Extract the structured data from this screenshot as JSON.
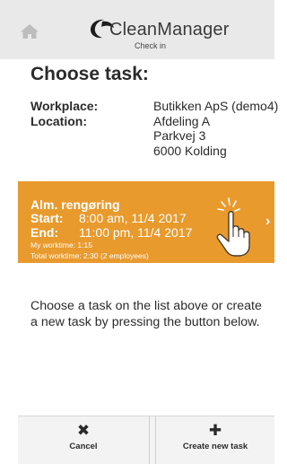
{
  "header": {
    "home_icon": "home-icon",
    "logo_icon": "cleanmanager-logo-icon",
    "app_title": "CleanManager",
    "subtitle": "Check in"
  },
  "main": {
    "title": "Choose task:",
    "info": [
      {
        "label": "Workplace:",
        "value": "Butikken ApS (demo4)"
      },
      {
        "label": "Location:",
        "value": "Afdeling A"
      },
      {
        "label": "",
        "value": "Parkvej 3"
      },
      {
        "label": "",
        "value": "6000 Kolding"
      }
    ],
    "task": {
      "name": "Alm. rengøring",
      "start_label": "Start:",
      "start_value": "8:00 am, 11/4 2017",
      "end_label": "End:",
      "end_value": "11:00 pm, 11/4 2017",
      "my_worktime": "My worktime: 1:15",
      "total_worktime": "Total worktime: 2:30 (2 employees)",
      "color": "#e89a2d",
      "tap_icon": "hand-pointer-icon",
      "chevron_icon": "chevron-right-icon",
      "chevron": "›"
    },
    "instruction": "Choose a task on the list above or create a new task by pressing the button below."
  },
  "footer": {
    "cancel_icon": "✖",
    "cancel_label": "Cancel",
    "create_icon": "✚",
    "create_label": "Create new task"
  }
}
